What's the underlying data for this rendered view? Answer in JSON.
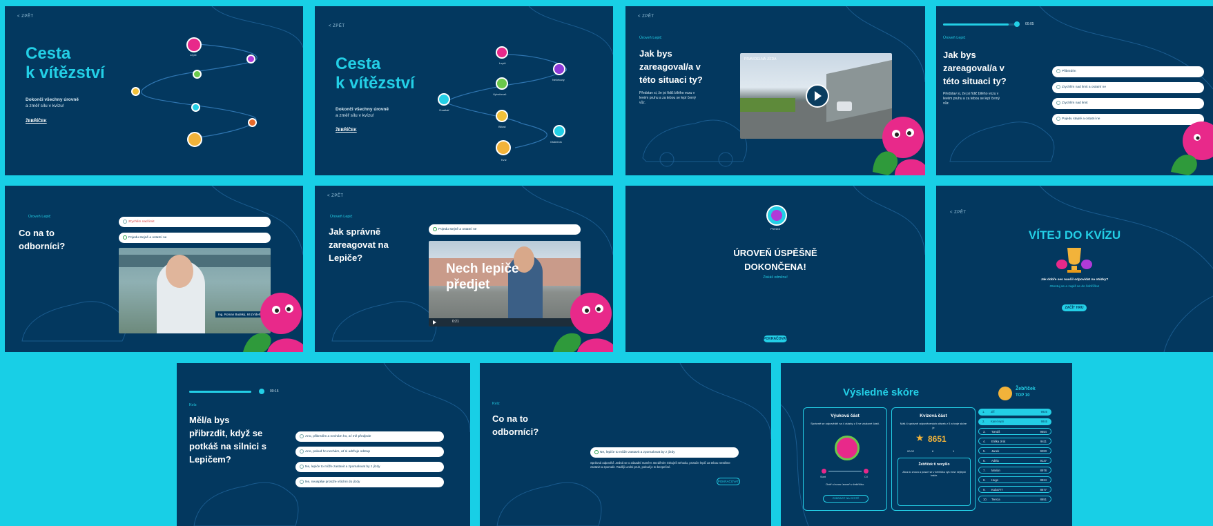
{
  "colors": {
    "background": "#18cfe6",
    "panel": "#03385f",
    "accent": "#23cfe6",
    "pink": "#e8298a",
    "text": "#ffffff"
  },
  "common": {
    "back_label": "< ZPĚT"
  },
  "p1": {
    "title_line1": "Cesta",
    "title_line2": "k vítězství",
    "subtitle_line1": "Dokonči všechny úrovně",
    "subtitle_line2": "a změř sílu v kvízu!",
    "link": "ŽEBŘÍČEK",
    "nodes": [
      "Lepič"
    ]
  },
  "p2": {
    "title_line1": "Cesta",
    "title_line2": "k vítězství",
    "subtitle_line1": "Dokonči všechny úrovně",
    "subtitle_line2": "a změř sílu v kvízu!",
    "link": "ŽEBŘÍČEK",
    "nodes": [
      "Lepič",
      "Nečekaný",
      "Vybočovač",
      "Zmatkář",
      "Blikač",
      "Otálečník",
      "Kvíz"
    ]
  },
  "p3": {
    "label": "Úroveň Lepič",
    "heading": [
      "Jak bys",
      "zareagoval/a v",
      "této situaci ty?"
    ],
    "text": [
      "Představ si, že jsi řidič bílého vozu v",
      "levém pruhu a za tebou se lepí černý",
      "vůz."
    ],
    "video_caption": "PRAVIDELNÁ JÍZDA"
  },
  "p4": {
    "timer": "00:05",
    "label": "Úroveň Lepič",
    "heading": [
      "Jak bys",
      "zareagoval/a v",
      "této situaci ty?"
    ],
    "text": [
      "Představ si, že jsi řidič bílého vozu v",
      "levém pruhu a za tebou se lepí černý",
      "vůz."
    ],
    "options": [
      "Přibrzdím",
      "Zrychlím nad limit a ostatní ne",
      "Zrychlím nad limit",
      "Pojedu stejně a ostatní ne"
    ]
  },
  "p5": {
    "label": "Úroveň Lepič",
    "heading": [
      "Co na to",
      "odborníci?"
    ],
    "options": [
      "Zrychlím nad limit",
      "Pojedu stejně a ostatní ne"
    ],
    "expert": "Ing. Roman Budský, 84 (Vídeň, RBA)"
  },
  "p6": {
    "label": "Úroveň Lepič",
    "heading": [
      "Jak správně",
      "zareagovat na",
      "Lepiče?"
    ],
    "option": "Pojedu stejně a ostatní ne",
    "video_text": [
      "Nech lepiče",
      "předjet"
    ],
    "video_time": "0:21"
  },
  "p7": {
    "badge_label": "Přehled",
    "heading": [
      "ÚROVEŇ ÚSPĚŠNĚ",
      "DOKONČENA!"
    ],
    "sub": "Získáš odměnu!",
    "button": "POKRAČOVAT"
  },
  "p8": {
    "title": "VÍTEJ DO KVÍZU",
    "q1": "Jak dobře ses naučil odpovídat na otázky?",
    "q2": "Otestuj se a zapiš se do žebříčku!",
    "button": "ZAČÍT HRU"
  },
  "p9": {
    "timer": "00:15",
    "label": "Kvíz",
    "heading": [
      "Měl/a bys",
      "přibrzdit, když se",
      "potkáš na silnici s",
      "Lepičem?"
    ],
    "options": [
      "Ano, přibrzdím a nechám ho, ať mě předjede",
      "Ano, pokud ho nechám, ať si udržuje odstup",
      "Ne, lepiče to může zastavit a zpomalovat by z jízdy",
      "Ne, neuspěje protože všichni do jízdy"
    ]
  },
  "p10": {
    "label": "Kvíz",
    "heading": [
      "Co na to",
      "odborníci?"
    ],
    "option": "Ne, lepiče to může zastavit a zpomalovat by z jízdy",
    "explanation": "Správná odpověď: Jedná se o zásadní manévr. Brzděním riskuješ nehodu, protože lepič za tebou nestihne zastavit a zpomalit. Raději uvolni pruh, pokud je to bezpečné.",
    "button": "POKRAČOVAT"
  },
  "p11": {
    "title": "Výsledné skóre",
    "level_title": "Výuková část",
    "level_text": "Správně se odpověděl na 4 otázky z 5 ve výukové části.",
    "quiz_title": "Kvízová část",
    "quiz_text": "Máš 4 správně odpovězených otázek z 5 a tvoje skóre je",
    "score": "8651",
    "stats": [
      "00:02",
      "6",
      "1"
    ],
    "range": [
      "Start",
      "Cíl"
    ],
    "level_note": "Ověř si svou úroveň v žebříčku.",
    "level_button": "ZOBRAZIT NA CESTĚ",
    "missing_title": "Žebříček ti nevyšlo",
    "missing_text": "Zkus to znovu a posuň se v žebříčku výš mezi nejlepší hráče.",
    "ladder_title": "Žebříček",
    "ladder_sub": "TOP 10",
    "ladder": [
      {
        "rank": "1.",
        "name": "Jiří",
        "score": "9925"
      },
      {
        "rank": "2.",
        "name": "Karel Ajeti",
        "score": "9845"
      },
      {
        "rank": "3.",
        "name": "Tomáš",
        "score": "9654"
      },
      {
        "rank": "4.",
        "name": "Eliška Jirát",
        "score": "9411"
      },
      {
        "rank": "5.",
        "name": "Janek",
        "score": "9283"
      },
      {
        "rank": "6.",
        "name": "Adéla",
        "score": "9137"
      },
      {
        "rank": "7.",
        "name": "Marián",
        "score": "8978"
      },
      {
        "rank": "8.",
        "name": "Hugo",
        "score": "8824"
      },
      {
        "rank": "9.",
        "name": "Kuba777",
        "score": "8677"
      },
      {
        "rank": "10.",
        "name": "Tereza",
        "score": "8651"
      }
    ]
  }
}
